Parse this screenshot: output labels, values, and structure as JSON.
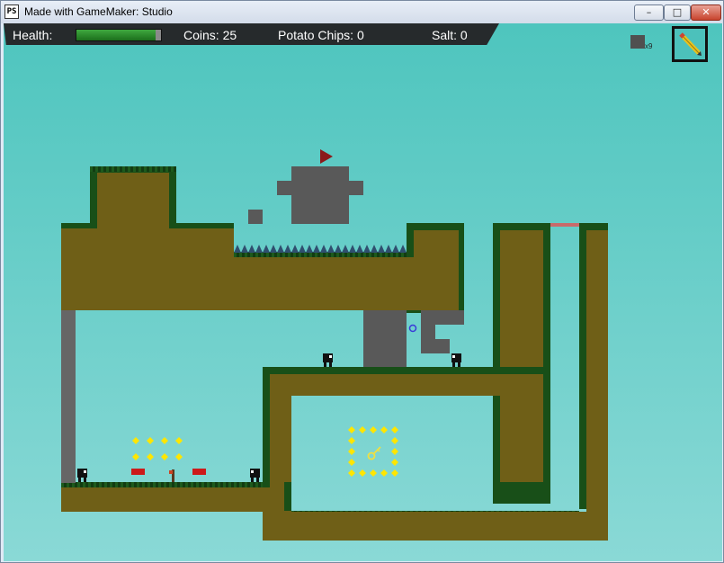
{
  "window": {
    "title": "Made with GameMaker: Studio",
    "app_icon_text": "PS",
    "minimize_glyph": "–",
    "maximize_glyph": "□",
    "close_glyph": "✕"
  },
  "hud": {
    "health_label": "Health:",
    "health_fraction": 0.94,
    "coins_text": "Coins: 25",
    "chips_text": "Potato Chips: 0",
    "salt_text": "Salt: 0"
  },
  "inventory": {
    "block_count": "x9",
    "selected_tool": "pencil-icon"
  },
  "colors": {
    "sky": "#57c8c2",
    "dirt": "#6f5f17",
    "grass": "#184f18",
    "stone": "#595959",
    "coin": "#ffe600",
    "spike": "#2f4f6f",
    "enemy": "#111111",
    "sign": "#cc1a1a"
  }
}
